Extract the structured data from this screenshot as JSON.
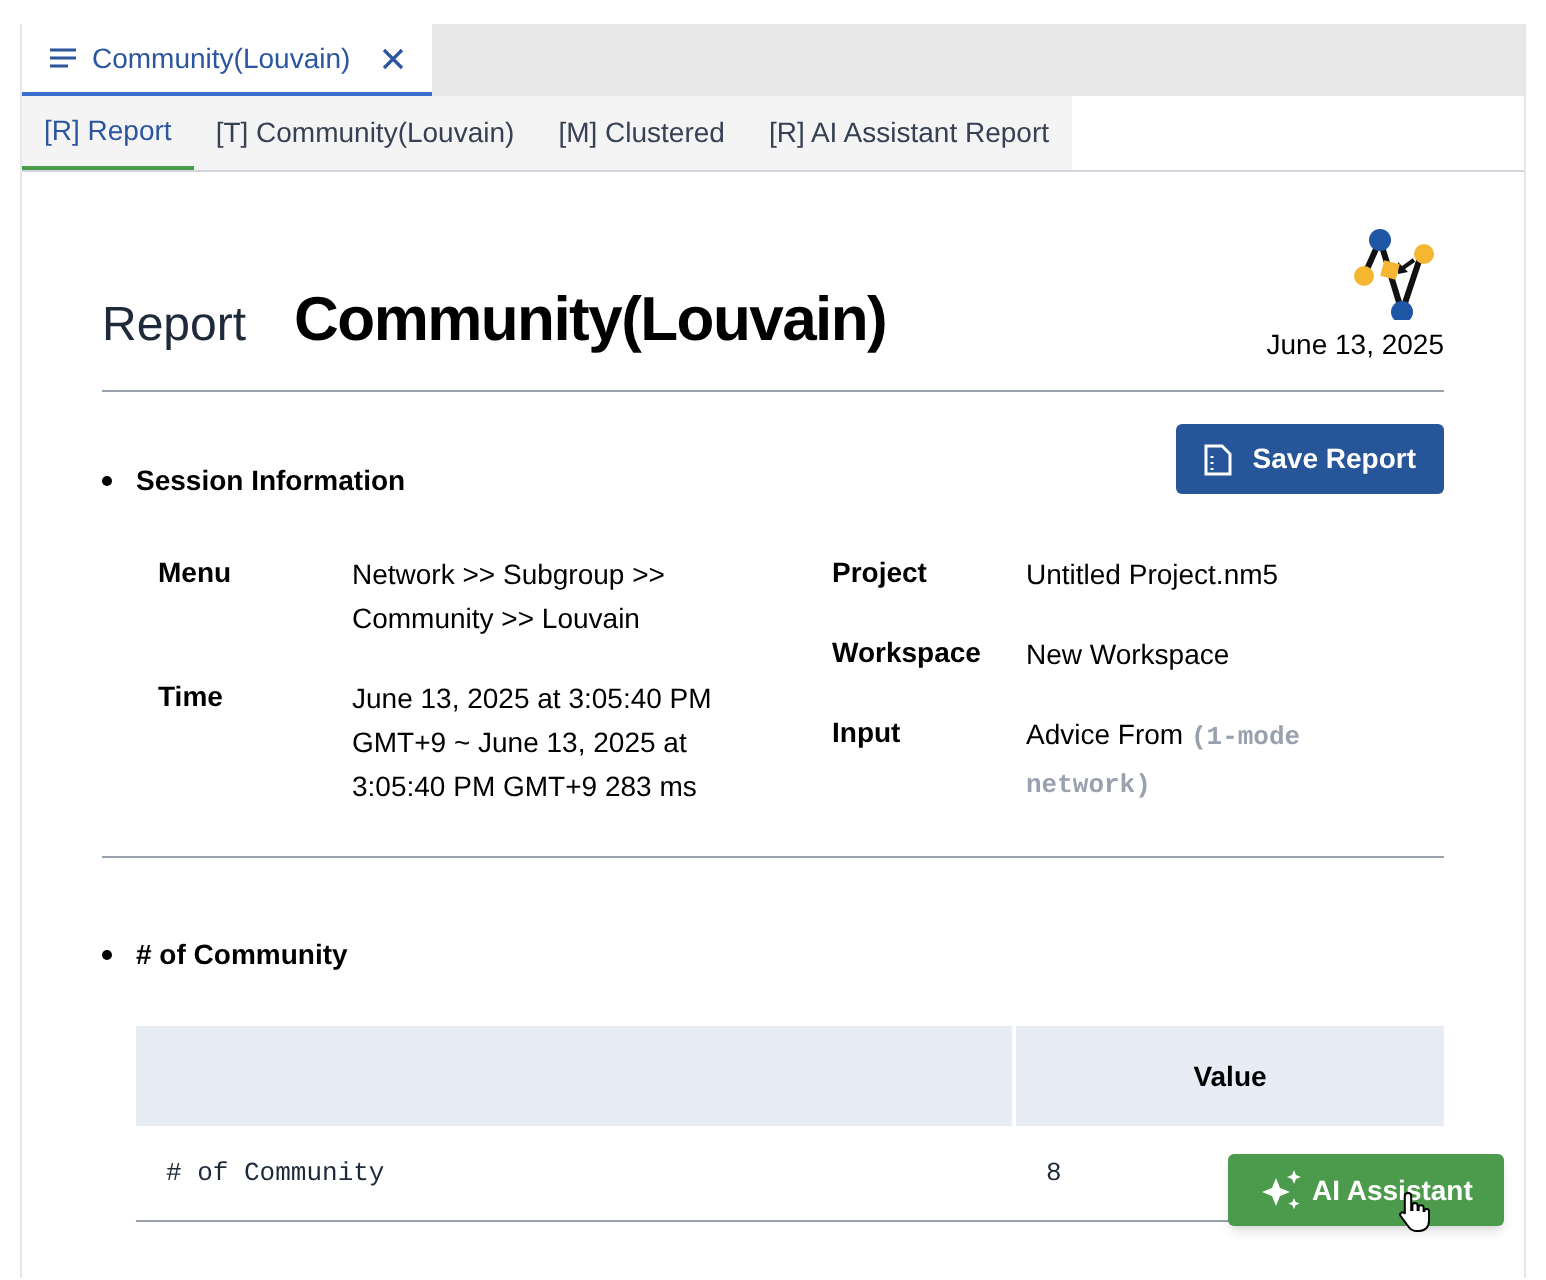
{
  "doc_tabs": [
    {
      "label": "Community(Louvain)",
      "selected": true
    }
  ],
  "view_tabs": [
    {
      "label": "[R] Report",
      "selected": true
    },
    {
      "label": "[T] Community(Louvain)",
      "selected": false
    },
    {
      "label": "[M] Clustered",
      "selected": false
    },
    {
      "label": "[R] AI Assistant Report",
      "selected": false
    }
  ],
  "report": {
    "kind_label": "Report",
    "title": "Community(Louvain)",
    "date": "June 13, 2025",
    "save_button": "Save Report"
  },
  "sections": [
    {
      "title": "Session Information",
      "kind": "info",
      "left": [
        {
          "label": "Menu",
          "value": "Network >> Subgroup >> Community >> Louvain"
        },
        {
          "label": "Time",
          "value": "June 13, 2025 at 3:05:40 PM GMT+9 ~ June 13, 2025 at 3:05:40 PM GMT+9 283 ms"
        }
      ],
      "right": [
        {
          "label": "Project",
          "value": "Untitled Project.nm5"
        },
        {
          "label": "Workspace",
          "value": "New Workspace"
        },
        {
          "label": "Input",
          "value": "Advice From",
          "code": "(1-mode network)"
        }
      ]
    },
    {
      "title": "# of Community",
      "kind": "table",
      "columns": [
        "Value"
      ],
      "rows": [
        [
          "# of Community",
          "8"
        ]
      ]
    }
  ],
  "ai_button": "AI Assistant"
}
